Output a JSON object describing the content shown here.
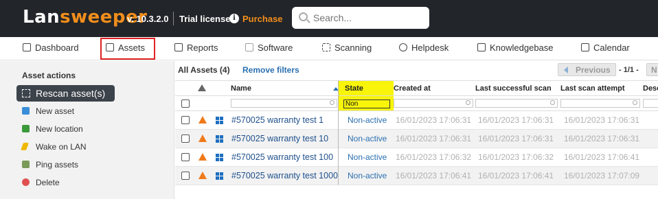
{
  "header": {
    "logo_part1": "Lan",
    "logo_part2": "sweeper",
    "version": "v. 10.3.2.0",
    "license": "Trial license",
    "purchase": "Purchase",
    "search_placeholder": "Search..."
  },
  "nav": [
    {
      "label": "Dashboard",
      "icon": "dashboard-icon"
    },
    {
      "label": "Assets",
      "icon": "monitor-icon"
    },
    {
      "label": "Reports",
      "icon": "reports-icon"
    },
    {
      "label": "Software",
      "icon": "software-icon"
    },
    {
      "label": "Scanning",
      "icon": "scanning-icon"
    },
    {
      "label": "Helpdesk",
      "icon": "helpdesk-icon"
    },
    {
      "label": "Knowledgebase",
      "icon": "knowledgebase-icon"
    },
    {
      "label": "Calendar",
      "icon": "calendar-icon"
    }
  ],
  "sidebar": {
    "title": "Asset actions",
    "rescan": "Rescan asset(s)",
    "items": [
      {
        "label": "New asset",
        "icon": "plus-icon",
        "color": "#3a8dd8"
      },
      {
        "label": "New location",
        "icon": "plus-icon",
        "color": "#3a9a3a"
      },
      {
        "label": "Wake on LAN",
        "icon": "lightning-icon",
        "color": "#f0b800"
      },
      {
        "label": "Ping assets",
        "icon": "ping-icon",
        "color": "#7a9a5a"
      },
      {
        "label": "Delete",
        "icon": "delete-icon",
        "color": "#e05050"
      }
    ]
  },
  "main": {
    "all_assets": "All Assets (4)",
    "remove_filters": "Remove filters",
    "previous": "Previous",
    "pager": "- 1/1 -",
    "next": "N",
    "columns": {
      "name": "Name",
      "state": "State",
      "created": "Created at",
      "last_success": "Last successful scan",
      "last_attempt": "Last scan attempt",
      "description": "Desc"
    },
    "state_filter": "Non",
    "rows": [
      {
        "name": "#570025 warranty test 1",
        "state": "Non-active",
        "created": "16/01/2023 17:06:31",
        "last_success": "16/01/2023 17:06:31",
        "last_attempt": "16/01/2023 17:06:31"
      },
      {
        "name": "#570025 warranty test 10",
        "state": "Non-active",
        "created": "16/01/2023 17:06:31",
        "last_success": "16/01/2023 17:06:31",
        "last_attempt": "16/01/2023 17:06:31"
      },
      {
        "name": "#570025 warranty test 100",
        "state": "Non-active",
        "created": "16/01/2023 17:06:32",
        "last_success": "16/01/2023 17:06:32",
        "last_attempt": "16/01/2023 17:06:41"
      },
      {
        "name": "#570025 warranty test 1000",
        "state": "Non-active",
        "created": "16/01/2023 17:06:41",
        "last_success": "16/01/2023 17:06:41",
        "last_attempt": "16/01/2023 17:07:09"
      }
    ]
  }
}
